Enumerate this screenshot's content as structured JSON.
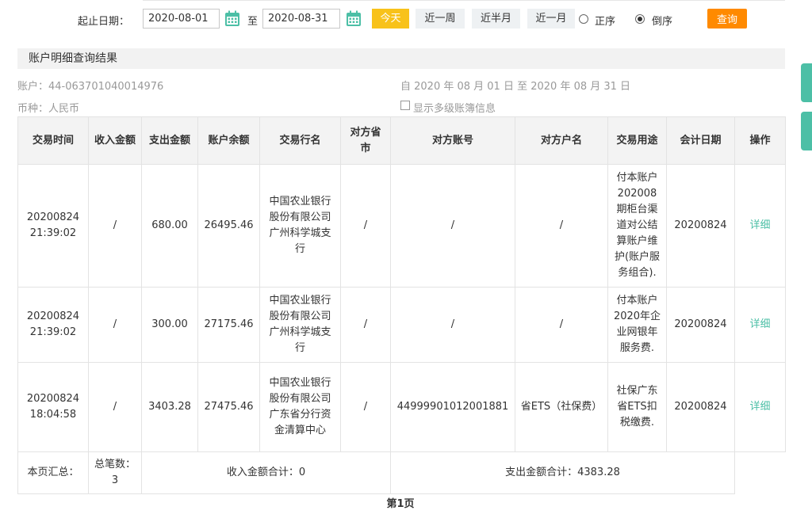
{
  "query": {
    "label": "起止日期：",
    "start_date": "2020-08-01",
    "to_text": "至",
    "end_date": "2020-08-31",
    "quick_buttons": [
      "今天",
      "近一周",
      "近半月",
      "近一月"
    ],
    "sort_asc_label": "正序",
    "sort_desc_label": "倒序",
    "sort_selected": "倒序",
    "search_label": "查询",
    "accent_color": "#f8c21a",
    "search_color": "#ff8a00",
    "icon": "calendar-icon"
  },
  "result": {
    "title": "账户明细查询结果",
    "account": "账户：44-063701040014976",
    "currency": "币种：人民币",
    "period": "自 2020 年 08 月 01 日 至 2020 年 08 月 31 日",
    "show_multi_level": "显示多级账簿信息"
  },
  "table": {
    "headers": [
      "交易时间",
      "收入金额",
      "支出金额",
      "账户余额",
      "交易行名",
      "对方省市",
      "对方账号",
      "对方户名",
      "交易用途",
      "会计日期",
      "操作"
    ],
    "rows": [
      {
        "date": "20200824",
        "time": "21:39:02",
        "income": "/",
        "expense": "680.00",
        "balance": "26495.46",
        "bank": "中国农业银行股份有限公司广州科学城支行",
        "province": "/",
        "account": "/",
        "name": "/",
        "purpose": "付本账户202008期柜台渠道对公结算账户维护(账户服务组合).",
        "acct_date": "20200824",
        "action": "详细"
      },
      {
        "date": "20200824",
        "time": "21:39:02",
        "income": "/",
        "expense": "300.00",
        "balance": "27175.46",
        "bank": "中国农业银行股份有限公司广州科学城支行",
        "province": "/",
        "account": "/",
        "name": "/",
        "purpose": "付本账户2020年企业网银年服务费.",
        "acct_date": "20200824",
        "action": "详细"
      },
      {
        "date": "20200824",
        "time": "18:04:58",
        "income": "/",
        "expense": "3403.28",
        "balance": "27475.46",
        "bank": "中国农业银行股份有限公司广东省分行资金清算中心",
        "province": "/",
        "account": "44999901012001881",
        "name": "省ETS（社保费）",
        "purpose": "社保广东省ETS扣税缴费.",
        "acct_date": "20200824",
        "action": "详细"
      }
    ],
    "summary": {
      "label": "本页汇总：",
      "count": "总笔数：3",
      "income_total": "收入金额合计：0",
      "expense_total": "支出金额合计：4383.28"
    },
    "link_color": "#4cbfa6"
  },
  "pager": {
    "label": "第1页"
  }
}
